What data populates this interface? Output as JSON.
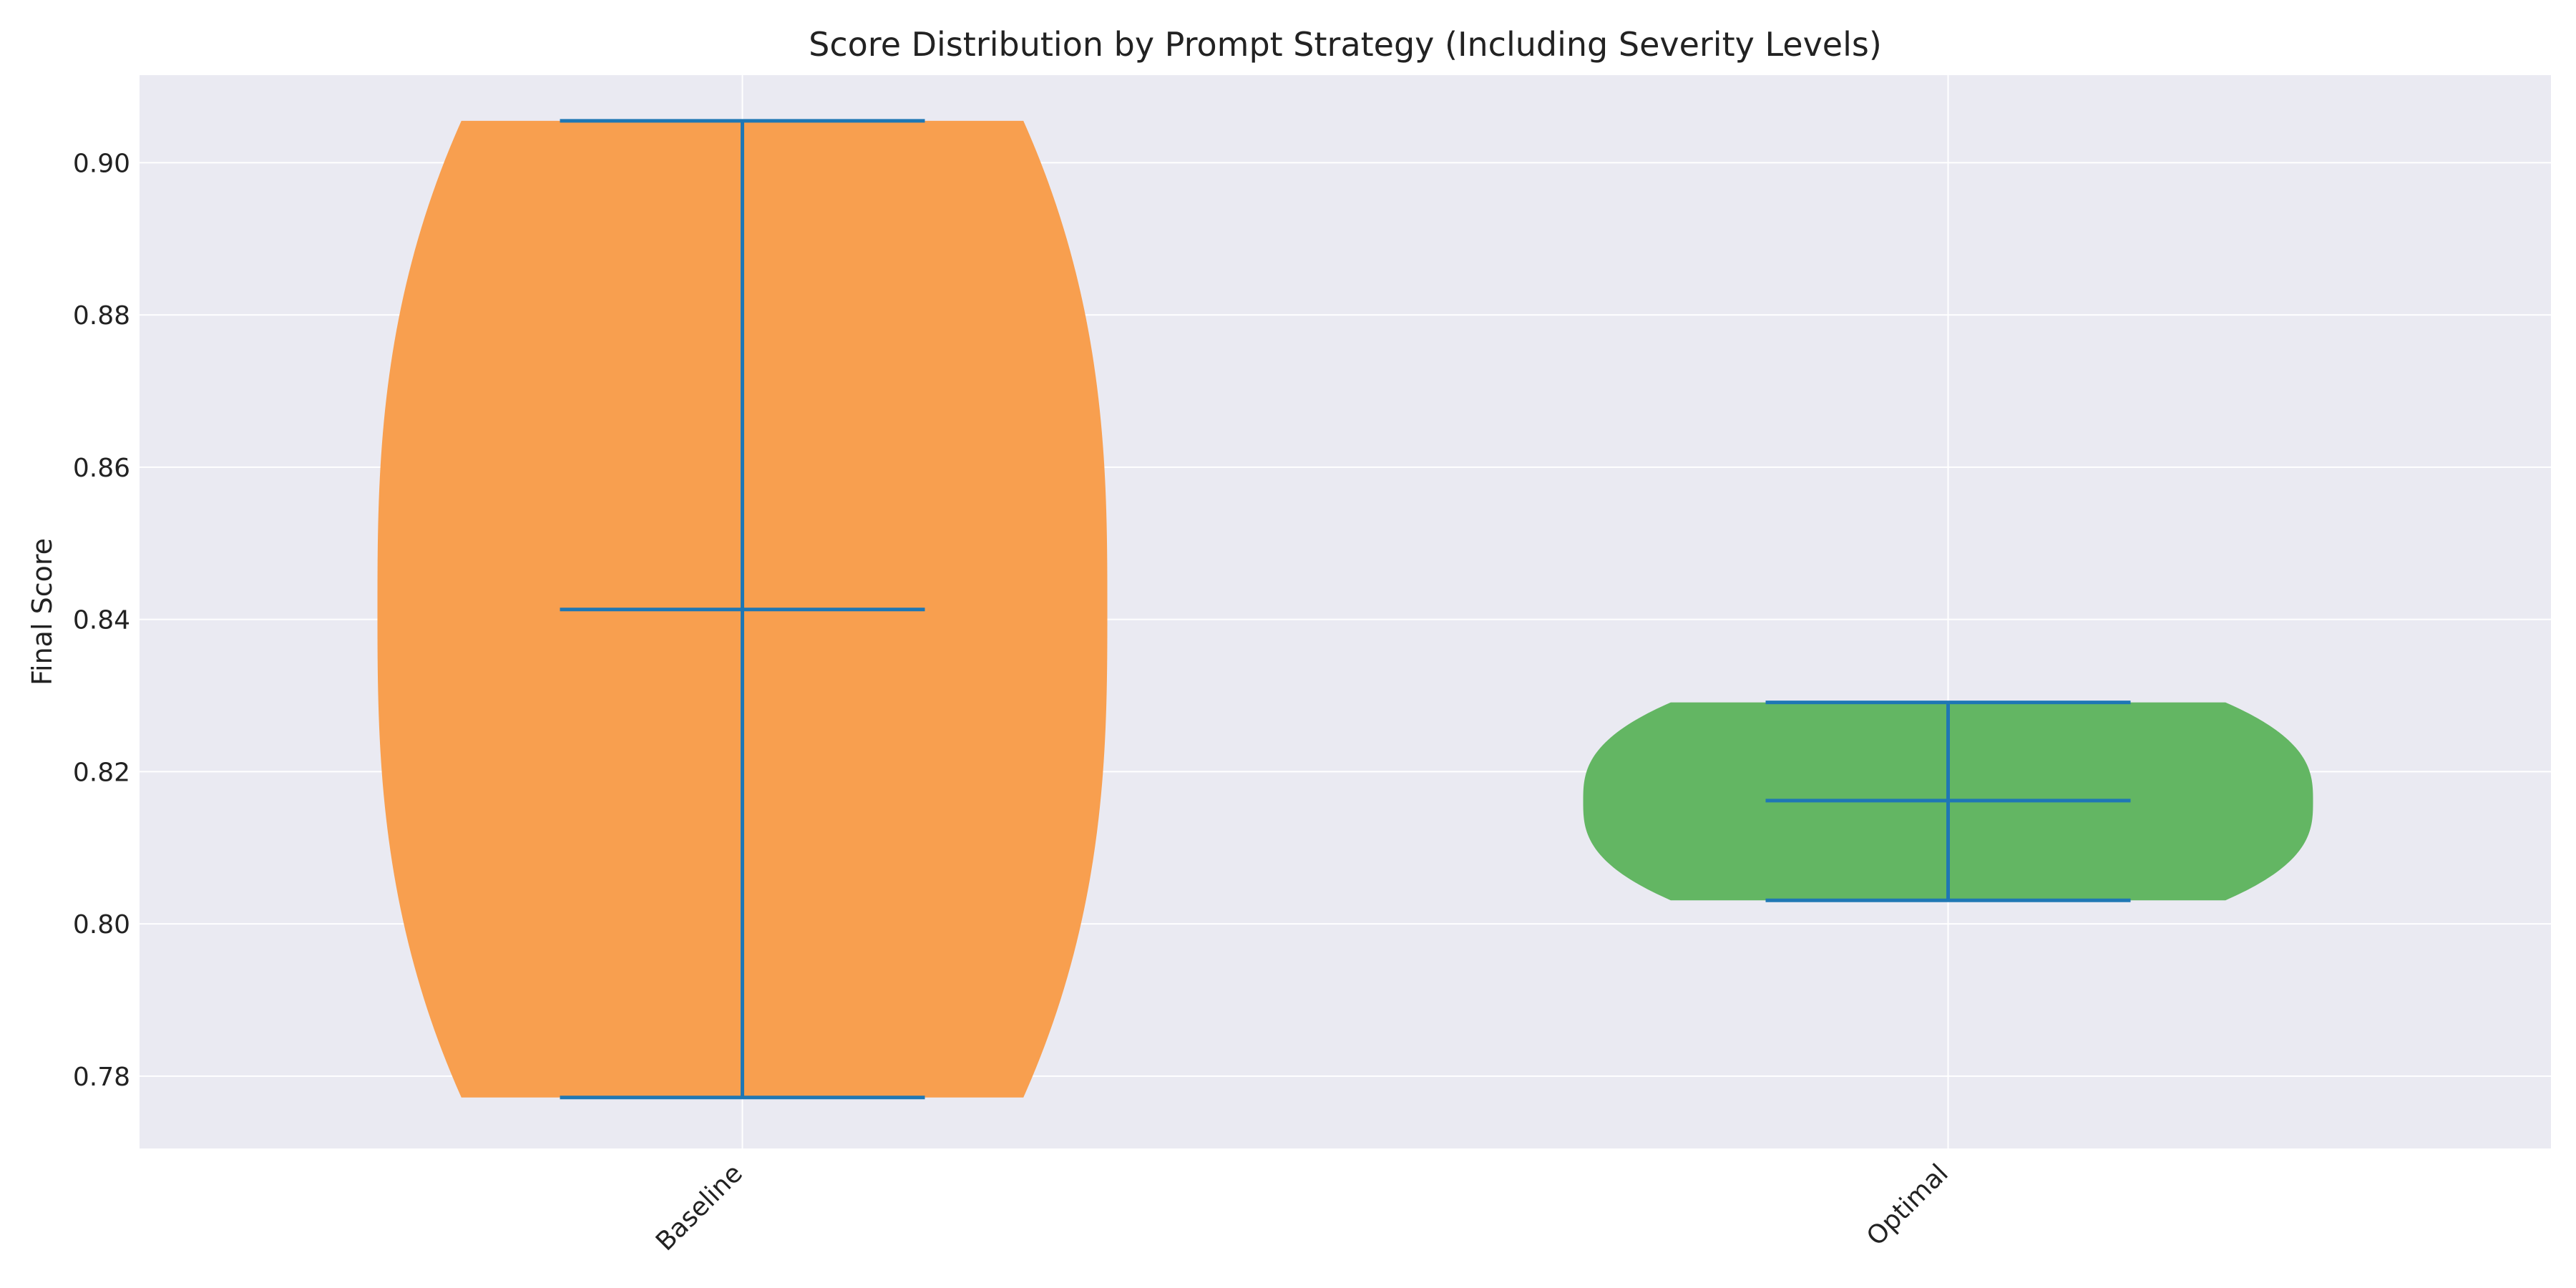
{
  "chart_data": {
    "type": "violin",
    "title": "Score Distribution by Prompt Strategy (Including Severity Levels)",
    "xlabel": "",
    "ylabel": "Final Score",
    "ylim": [
      0.7705,
      0.9115
    ],
    "yticks": [
      0.78,
      0.8,
      0.82,
      0.84,
      0.86,
      0.88,
      0.9
    ],
    "ytick_labels": [
      "0.78",
      "0.80",
      "0.82",
      "0.84",
      "0.86",
      "0.88",
      "0.90"
    ],
    "grid": true,
    "categories": [
      "Baseline",
      "Optimal"
    ],
    "series": [
      {
        "category": "Baseline",
        "min": 0.7772,
        "median": 0.8413,
        "max": 0.9055,
        "color": "#F89F4F"
      },
      {
        "category": "Optimal",
        "min": 0.8031,
        "median": 0.8162,
        "max": 0.8291,
        "color": "#63B663"
      }
    ],
    "line_color": "#1F77B4",
    "background_color": "#EAEAF2"
  }
}
